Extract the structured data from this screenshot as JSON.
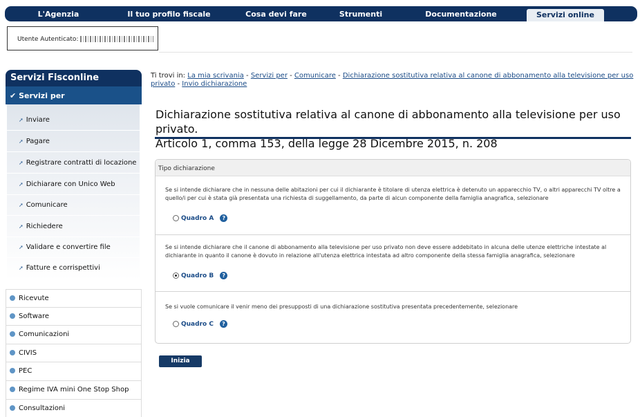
{
  "topnav": {
    "items": [
      "L'Agenzia",
      "Il tuo profilo fiscale",
      "Cosa devi fare",
      "Strumenti",
      "Documentazione",
      "Servizi online"
    ]
  },
  "user": {
    "label": "Utente Autenticato:"
  },
  "sidebar": {
    "title": "Servizi Fisconline",
    "section": "Servizi per",
    "subitems": [
      "Inviare",
      "Pagare",
      "Registrare contratti di locazione",
      "Dichiarare con Unico Web",
      "Comunicare",
      "Richiedere",
      "Validare e convertire file",
      "Fatture e corrispettivi"
    ],
    "list": [
      "Ricevute",
      "Software",
      "Comunicazioni",
      "CIVIS",
      "PEC",
      "Regime IVA mini One Stop Shop",
      "Consultazioni"
    ]
  },
  "breadcrumb": {
    "prefix": "Ti trovi in:",
    "links": [
      "La mia scrivania",
      "Servizi per",
      "Comunicare",
      "Dichiarazione sostitutiva relativa al canone di abbonamento alla televisione per uso privato",
      "Invio dichiarazione"
    ]
  },
  "page": {
    "title_line1": "Dichiarazione sostitutiva relativa al canone di abbonamento alla televisione per uso privato.",
    "title_line2": "Articolo 1, comma 153, della legge 28 Dicembre 2015, n. 208"
  },
  "form": {
    "header": "Tipo dichiarazione",
    "sections": [
      {
        "text": "Se si intende dichiarare che in nessuna delle abitazioni per cui il dichiarante è titolare di utenza elettrica è detenuto un apparecchio TV, o altri apparecchi TV oltre a quello/i per cui è stata già presentata una richiesta di suggellamento, da parte di alcun componente della famiglia anagrafica, selezionare",
        "option": "Quadro A",
        "selected": false
      },
      {
        "text": "Se si intende dichiarare che il canone di abbonamento alla televisione per uso privato non deve essere addebitato in alcuna delle utenze elettriche intestate al dichiarante in quanto il canone è dovuto in relazione all'utenza elettrica intestata ad altro componente della stessa famiglia anagrafica, selezionare",
        "option": "Quadro B",
        "selected": true
      },
      {
        "text": "Se si vuole comunicare il venir meno dei presupposti di una dichiarazione sostitutiva presentata precedentemente, selezionare",
        "option": "Quadro C",
        "selected": false
      }
    ],
    "submit": "Inizia"
  }
}
